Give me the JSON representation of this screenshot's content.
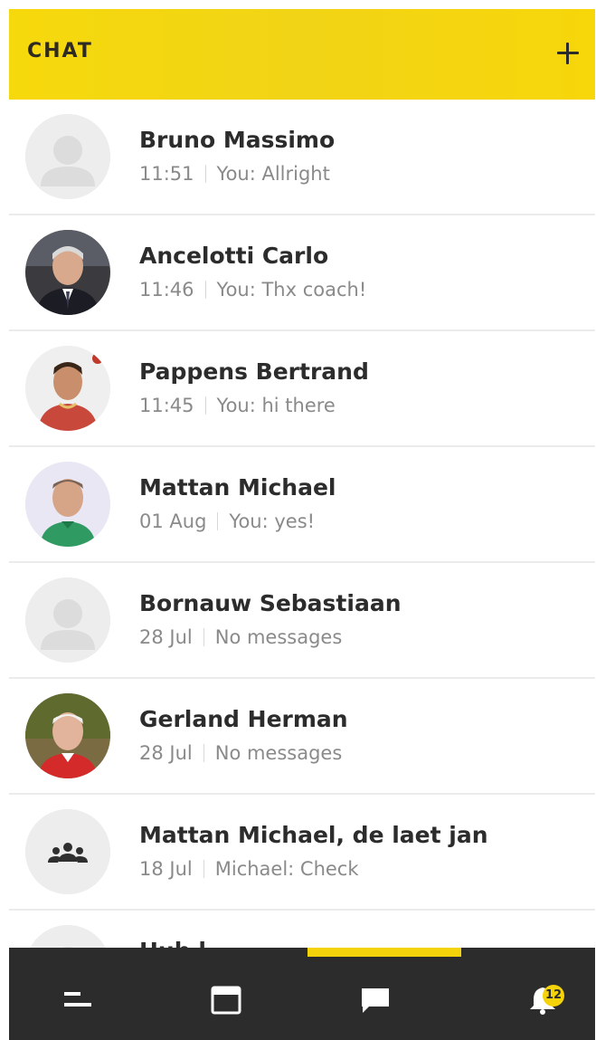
{
  "header": {
    "title": "CHAT",
    "add_icon": "plus-icon"
  },
  "chats": [
    {
      "name": "Bruno Massimo",
      "time": "11:51",
      "preview": "You: Allright",
      "avatar": "placeholder"
    },
    {
      "name": "Ancelotti Carlo",
      "time": "11:46",
      "preview": "You: Thx coach!",
      "avatar": "photo"
    },
    {
      "name": "Pappens Bertrand",
      "time": "11:45",
      "preview": "You: hi there",
      "avatar": "photo"
    },
    {
      "name": "Mattan Michael",
      "time": "01 Aug",
      "preview": "You: yes!",
      "avatar": "photo"
    },
    {
      "name": "Bornauw Sebastiaan",
      "time": "28 Jul",
      "preview": "No messages",
      "avatar": "placeholder"
    },
    {
      "name": "Gerland Herman",
      "time": "28 Jul",
      "preview": "No messages",
      "avatar": "photo"
    },
    {
      "name": "Mattan Michael, de laet jan",
      "time": "18 Jul",
      "preview": "Michael: Check",
      "avatar": "group"
    },
    {
      "name": "Hub l…",
      "time": "",
      "preview": "",
      "avatar": "placeholder"
    }
  ],
  "tabbar": {
    "tabs": [
      {
        "icon": "menu-icon"
      },
      {
        "icon": "calendar-icon"
      },
      {
        "icon": "chat-icon",
        "active": true
      },
      {
        "icon": "bell-icon"
      }
    ],
    "notification_count": "12"
  },
  "colors": {
    "accent": "#f5d30b",
    "tabbar": "#2c2c2c"
  }
}
